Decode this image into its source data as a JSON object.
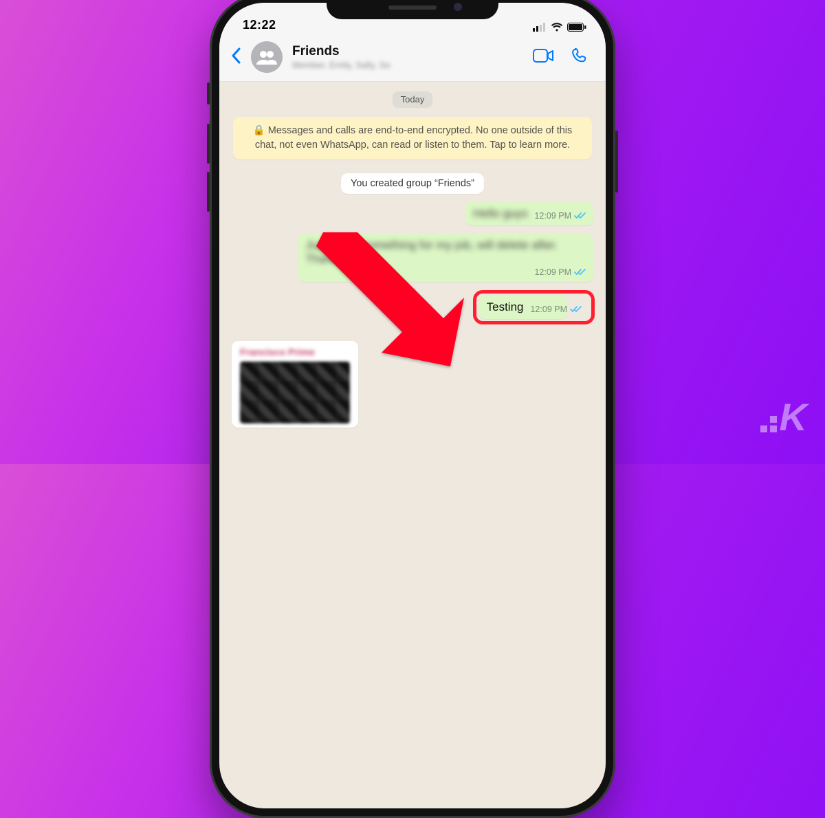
{
  "status": {
    "time": "12:22"
  },
  "header": {
    "group_name": "Friends",
    "subtitle_blurred": "Member, Emily, Sally, So"
  },
  "chat": {
    "date_label": "Today",
    "encryption_notice": "Messages and calls are end-to-end encrypted. No one outside of this chat, not even WhatsApp, can read or listen to them. Tap to learn more.",
    "system_msg": "You created group “Friends”",
    "messages": [
      {
        "text_blurred": "Hello guys",
        "time": "12:09 PM",
        "status": "read"
      },
      {
        "text_blurred": "Just doing something for my job, will delete after. Thanks",
        "time": "12:09 PM",
        "status": "read"
      },
      {
        "text": "Testing",
        "time": "12:09 PM",
        "status": "read",
        "highlighted": true
      }
    ],
    "incoming_sender_blurred": "Francisco Prime"
  },
  "icons": {
    "back": "chevron-left",
    "video": "video-camera",
    "call": "phone",
    "lock": "lock",
    "ticks": "double-check-read",
    "group_avatar": "people"
  },
  "colors": {
    "ios_blue": "#007aff",
    "bubble_out": "#dcf7c5",
    "tick_read": "#4fc3f7",
    "highlight_red": "#ff1f2e",
    "arrow_red": "#ff0020"
  }
}
